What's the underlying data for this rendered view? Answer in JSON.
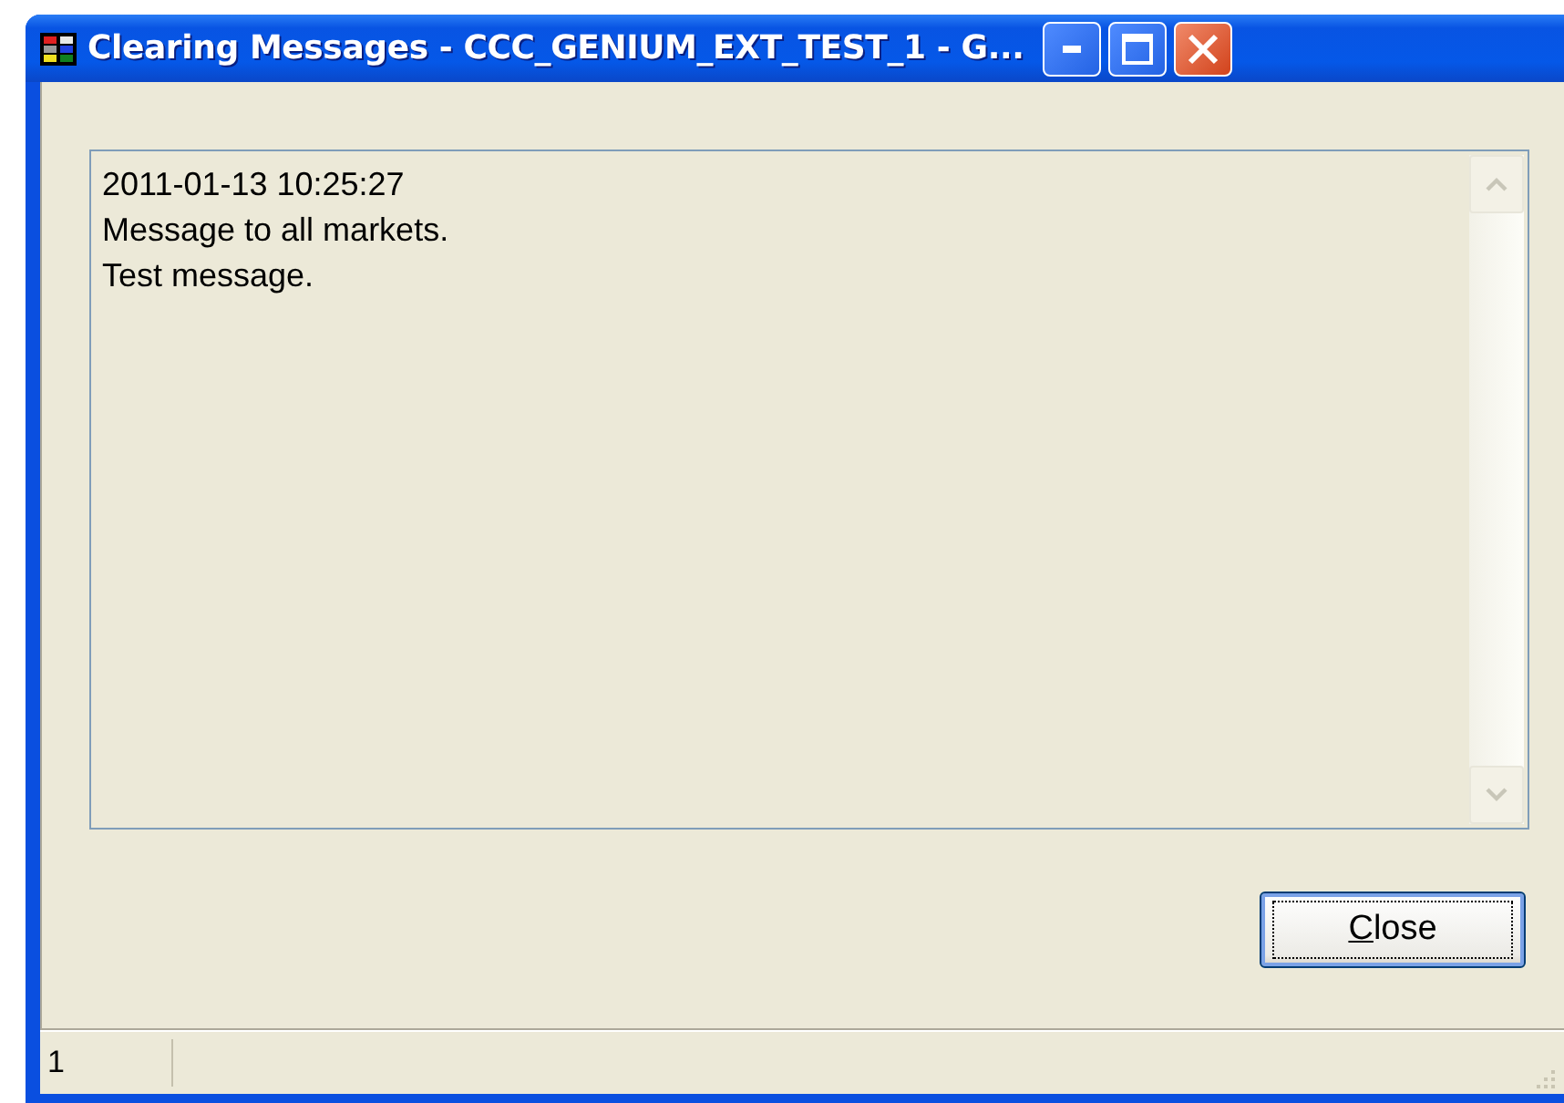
{
  "window": {
    "title": "Clearing Messages - CCC_GENIUM_EXT_TEST_1 - G..."
  },
  "message_box": {
    "lines": [
      "2011-01-13 10:25:27",
      "Message to all markets.",
      "Test message."
    ]
  },
  "buttons": [
    {
      "label": "Close",
      "default": true
    }
  ],
  "status_bar": {
    "panels": [
      "1"
    ]
  }
}
